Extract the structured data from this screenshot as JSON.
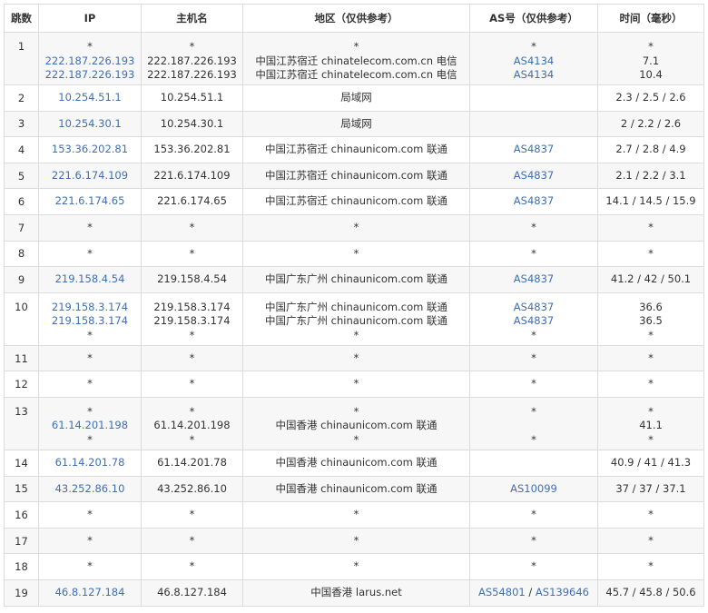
{
  "headers": {
    "hop": "跳数",
    "ip": "IP",
    "host": "主机名",
    "region": "地区（仅供参考）",
    "as": "AS号（仅供参考）",
    "time": "时间（毫秒）"
  },
  "rows": [
    {
      "hop": "1",
      "lines": [
        {
          "ip": "*",
          "host": "*",
          "region": "*",
          "as": "*",
          "time": "*"
        },
        {
          "ip": "222.187.226.193",
          "host": "222.187.226.193",
          "region": "中国江苏宿迁 chinatelecom.com.cn 电信",
          "as": "AS4134",
          "time": "7.1"
        },
        {
          "ip": "222.187.226.193",
          "host": "222.187.226.193",
          "region": "中国江苏宿迁 chinatelecom.com.cn 电信",
          "as": "AS4134",
          "time": "10.4"
        }
      ]
    },
    {
      "hop": "2",
      "lines": [
        {
          "ip": "10.254.51.1",
          "host": "10.254.51.1",
          "region": "局域网",
          "as": "",
          "time": "2.3 / 2.5 / 2.6"
        }
      ]
    },
    {
      "hop": "3",
      "lines": [
        {
          "ip": "10.254.30.1",
          "host": "10.254.30.1",
          "region": "局域网",
          "as": "",
          "time": "2 / 2.2 / 2.6"
        }
      ]
    },
    {
      "hop": "4",
      "lines": [
        {
          "ip": "153.36.202.81",
          "host": "153.36.202.81",
          "region": "中国江苏宿迁 chinaunicom.com 联通",
          "as": "AS4837",
          "time": "2.7 / 2.8 / 4.9"
        }
      ]
    },
    {
      "hop": "5",
      "lines": [
        {
          "ip": "221.6.174.109",
          "host": "221.6.174.109",
          "region": "中国江苏宿迁 chinaunicom.com 联通",
          "as": "AS4837",
          "time": "2.1 / 2.2 / 3.1"
        }
      ]
    },
    {
      "hop": "6",
      "lines": [
        {
          "ip": "221.6.174.65",
          "host": "221.6.174.65",
          "region": "中国江苏宿迁 chinaunicom.com 联通",
          "as": "AS4837",
          "time": "14.1 / 14.5 / 15.9"
        }
      ]
    },
    {
      "hop": "7",
      "lines": [
        {
          "ip": "*",
          "host": "*",
          "region": "*",
          "as": "*",
          "time": "*"
        }
      ]
    },
    {
      "hop": "8",
      "lines": [
        {
          "ip": "*",
          "host": "*",
          "region": "*",
          "as": "*",
          "time": "*"
        }
      ]
    },
    {
      "hop": "9",
      "lines": [
        {
          "ip": "219.158.4.54",
          "host": "219.158.4.54",
          "region": "中国广东广州 chinaunicom.com 联通",
          "as": "AS4837",
          "time": "41.2 / 42 / 50.1"
        }
      ]
    },
    {
      "hop": "10",
      "lines": [
        {
          "ip": "219.158.3.174",
          "host": "219.158.3.174",
          "region": "中国广东广州 chinaunicom.com 联通",
          "as": "AS4837",
          "time": "36.6"
        },
        {
          "ip": "219.158.3.174",
          "host": "219.158.3.174",
          "region": "中国广东广州 chinaunicom.com 联通",
          "as": "AS4837",
          "time": "36.5"
        },
        {
          "ip": "*",
          "host": "*",
          "region": "*",
          "as": "*",
          "time": "*"
        }
      ]
    },
    {
      "hop": "11",
      "lines": [
        {
          "ip": "*",
          "host": "*",
          "region": "*",
          "as": "*",
          "time": "*"
        }
      ]
    },
    {
      "hop": "12",
      "lines": [
        {
          "ip": "*",
          "host": "*",
          "region": "*",
          "as": "*",
          "time": "*"
        }
      ]
    },
    {
      "hop": "13",
      "lines": [
        {
          "ip": "*",
          "host": "*",
          "region": "*",
          "as": "*",
          "time": "*"
        },
        {
          "ip": "61.14.201.198",
          "host": "61.14.201.198",
          "region": "中国香港 chinaunicom.com 联通",
          "as": "",
          "time": "41.1"
        },
        {
          "ip": "*",
          "host": "*",
          "region": "*",
          "as": "*",
          "time": "*"
        }
      ]
    },
    {
      "hop": "14",
      "lines": [
        {
          "ip": "61.14.201.78",
          "host": "61.14.201.78",
          "region": "中国香港 chinaunicom.com 联通",
          "as": "",
          "time": "40.9 / 41 / 41.3"
        }
      ]
    },
    {
      "hop": "15",
      "lines": [
        {
          "ip": "43.252.86.10",
          "host": "43.252.86.10",
          "region": "中国香港 chinaunicom.com 联通",
          "as": "AS10099",
          "time": "37 / 37 / 37.1"
        }
      ]
    },
    {
      "hop": "16",
      "lines": [
        {
          "ip": "*",
          "host": "*",
          "region": "*",
          "as": "*",
          "time": "*"
        }
      ]
    },
    {
      "hop": "17",
      "lines": [
        {
          "ip": "*",
          "host": "*",
          "region": "*",
          "as": "*",
          "time": "*"
        }
      ]
    },
    {
      "hop": "18",
      "lines": [
        {
          "ip": "*",
          "host": "*",
          "region": "*",
          "as": "*",
          "time": "*"
        }
      ]
    },
    {
      "hop": "19",
      "lines": [
        {
          "ip": "46.8.127.184",
          "host": "46.8.127.184",
          "region": "中国香港 larus.net",
          "as": "AS54801 / AS139646",
          "time": "45.7 / 45.8 / 50.6"
        }
      ]
    }
  ],
  "colors": {
    "link": "#3f6fb4",
    "border": "#dcdcdc",
    "alt_row": "#f7f7f7",
    "text": "#333333"
  }
}
